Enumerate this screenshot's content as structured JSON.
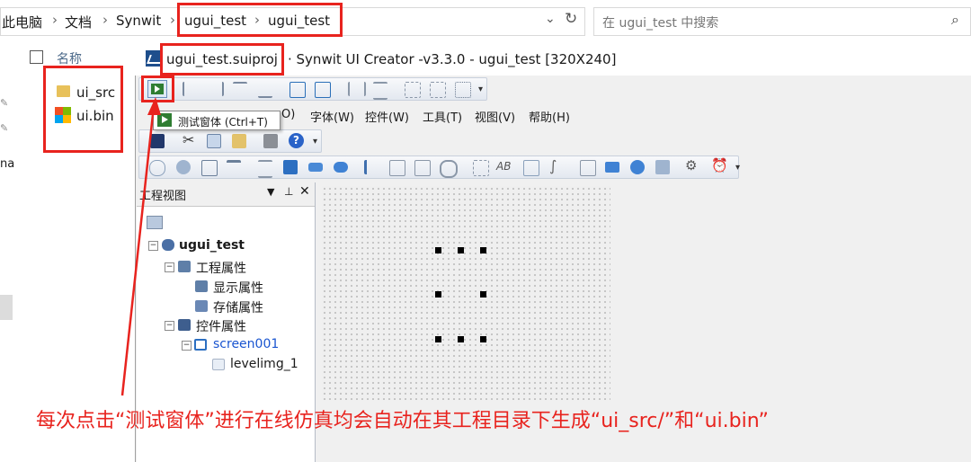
{
  "explorer": {
    "breadcrumbs": [
      "此电脑",
      "文档",
      "Synwit",
      "ugui_test",
      "ugui_test"
    ],
    "search_placeholder": "在 ugui_test 中搜索",
    "column_name": "名称",
    "files": [
      {
        "name": "ui_src",
        "icon": "folder-icon"
      },
      {
        "name": "ui.bin",
        "icon": "bin-file-icon"
      }
    ],
    "side_fragment": "na"
  },
  "app": {
    "project_file": "ugui_test.suiproj",
    "title": "· Synwit UI Creator -v3.3.0 - ugui_test [320X240]",
    "menu": [
      "O)",
      "字体(W)",
      "控件(W)",
      "工具(T)",
      "视图(V)",
      "帮助(H)"
    ],
    "tooltip": "测试窗体 (Ctrl+T)",
    "panel_title": "工程视图",
    "tree": {
      "root": "ugui_test",
      "project_props": "工程属性",
      "display_props": "显示属性",
      "storage_props": "存储属性",
      "widget_props": "控件属性",
      "screen": "screen001",
      "widget": "levelimg_1"
    }
  },
  "annotation": {
    "caption": "每次点击“测试窗体”进行在线仿真均会自动在其工程目录下生成“ui_src/”和“ui.bin”",
    "color": "#e8231e"
  }
}
